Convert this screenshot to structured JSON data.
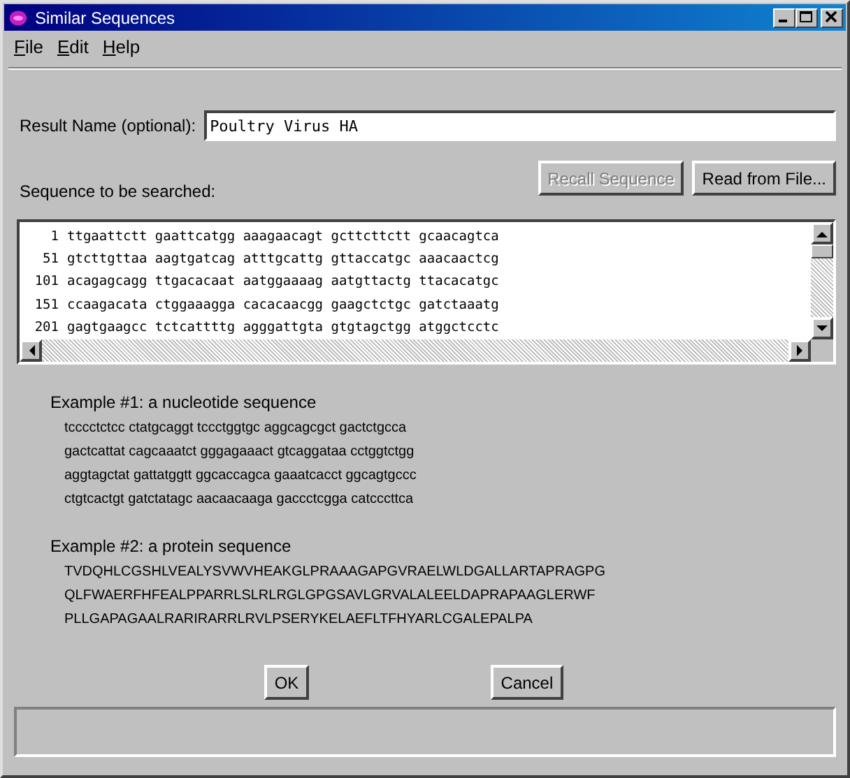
{
  "window": {
    "title": "Similar Sequences"
  },
  "menu": [
    "File",
    "Edit",
    "Help"
  ],
  "result_name": {
    "label": "Result Name (optional):",
    "value": "Poultry Virus HA"
  },
  "sequence_label": "Sequence to be searched:",
  "sequence_buttons": [
    {
      "label": "Recall Sequence",
      "disabled": true
    },
    {
      "label": "Read from File...",
      "disabled": false
    }
  ],
  "sequence_lines": [
    {
      "number": "1",
      "text": "ttgaattctt gaattcatgg aaagaacagt gcttcttctt gcaacagtca"
    },
    {
      "number": "51",
      "text": "gtcttgttaa aagtgatcag atttgcattg gttaccatgc aaacaactcg"
    },
    {
      "number": "101",
      "text": "acagagcagg ttgacacaat aatggaaaag aatgttactg ttacacatgc"
    },
    {
      "number": "151",
      "text": "ccaagacata ctggaaagga cacacaacgg gaagctctgc gatctaaatg"
    },
    {
      "number": "201",
      "text": "gagtgaagcc tctcattttg agggattgta gtgtagctgg atggctcctc"
    }
  ],
  "examples": [
    {
      "title": "Example #1: a nucleotide sequence",
      "lines": [
        "tcccctctcc ctatgcaggt tccctggtgc aggcagcgct gactctgcca",
        "gactcattat cagcaaatct gggagaaact gtcaggataa cctggtctgg",
        "aggtagctat gattatggtt ggcaccagca gaaatcacct ggcagtgccc",
        "ctgtcactgt gatctatagc aacaacaaga gaccctcgga catcccttca"
      ]
    },
    {
      "title": "Example #2: a protein sequence",
      "lines": [
        "TVDQHLCGSHLVEALYSVWVHEAKGLPRAAAGAPGVRAELWLDGALLARTAPRAGPG",
        "QLFWAERFHFEALPPARRLSLRLRGLGPGSAVLGRVALALEELDAPRAPAAGLERWF",
        "PLLGAPAGAALRARIRARRLRVLPSERYKELAEFLTFHYARLCGALEPALPA"
      ]
    }
  ],
  "dialog_buttons": [
    "OK",
    "Cancel"
  ]
}
